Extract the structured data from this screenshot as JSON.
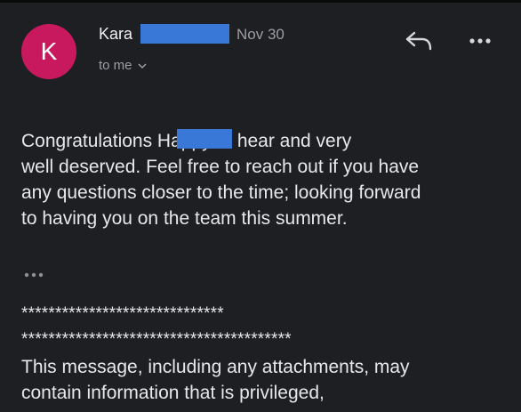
{
  "email": {
    "avatar_letter": "K",
    "sender_name": "Kara",
    "date": "Nov 30",
    "recipient_label": "to me",
    "body": "Congratulations                Happy to hear and very\nwell deserved. Feel free to reach out if you have\nany questions closer to the time; looking forward\nto having you on the team this summer.",
    "signature_line_1": "******************************",
    "signature_line_2": "****************************************",
    "disclaimer": "This message, including any attachments, may\ncontain information that is privileged,"
  },
  "colors": {
    "background": "#1e1f22",
    "avatar": "#c8195f",
    "redaction": "#3a78d8",
    "muted_text": "#9d9ea3",
    "text": "#e8e8ea"
  },
  "icons": {
    "reply": "reply-icon",
    "more": "more-horizontal-icon",
    "chevron": "chevron-down-icon",
    "trimmed": "trimmed-content-icon"
  }
}
